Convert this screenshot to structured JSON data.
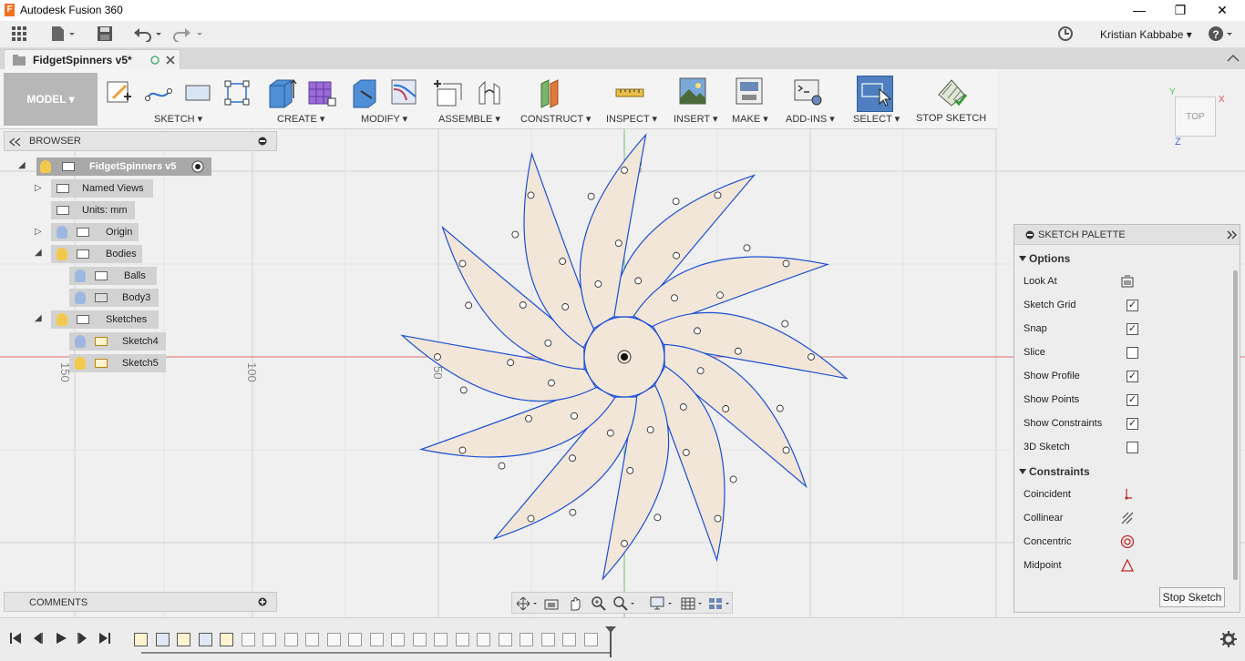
{
  "app": {
    "title": "Autodesk Fusion 360"
  },
  "window": {
    "minimize": "—",
    "restore": "❐",
    "close": "✕"
  },
  "user": {
    "name": "Kristian Kabbabe ▾",
    "help": "?"
  },
  "document": {
    "tab_label": "FidgetSpinners v5*"
  },
  "workspace": {
    "label": "MODEL ▾"
  },
  "ribbon": {
    "groups": [
      "SKETCH ▾",
      "CREATE ▾",
      "MODIFY ▾",
      "ASSEMBLE ▾",
      "CONSTRUCT ▾",
      "INSPECT ▾",
      "INSERT ▾",
      "MAKE ▾",
      "ADD-INS ▾",
      "SELECT ▾",
      "STOP SKETCH"
    ]
  },
  "browser": {
    "label": "BROWSER",
    "root": "FidgetSpinners v5",
    "items": [
      "Named Views",
      "Units: mm",
      "Origin",
      "Bodies",
      "Balls",
      "Body3",
      "Sketches",
      "Sketch4",
      "Sketch5"
    ]
  },
  "canvas": {
    "axis_labels": [
      "50",
      "50",
      "100",
      "150"
    ]
  },
  "viewcube": {
    "face": "TOP",
    "axis_z": "Z",
    "axis_x": "X",
    "axis_y": "Y"
  },
  "comments": {
    "label": "COMMENTS"
  },
  "palette": {
    "title": "SKETCH PALETTE",
    "options_header": "Options",
    "options": [
      {
        "label": "Look At"
      },
      {
        "label": "Sketch Grid",
        "checked": "✓"
      },
      {
        "label": "Snap",
        "checked": "✓"
      },
      {
        "label": "Slice",
        "checked": ""
      },
      {
        "label": "Show Profile",
        "checked": "✓"
      },
      {
        "label": "Show Points",
        "checked": "✓"
      },
      {
        "label": "Show Constraints",
        "checked": "✓"
      },
      {
        "label": "3D Sketch",
        "checked": ""
      }
    ],
    "constraints_header": "Constraints",
    "constraints": [
      "Coincident",
      "Collinear",
      "Concentric",
      "Midpoint"
    ],
    "stop_button": "Stop Sketch"
  },
  "colors": {
    "sketch_curve": "#1a4fd6",
    "profile_fill": "#f2e6d8",
    "selected_tool": "#4f7fbf"
  }
}
